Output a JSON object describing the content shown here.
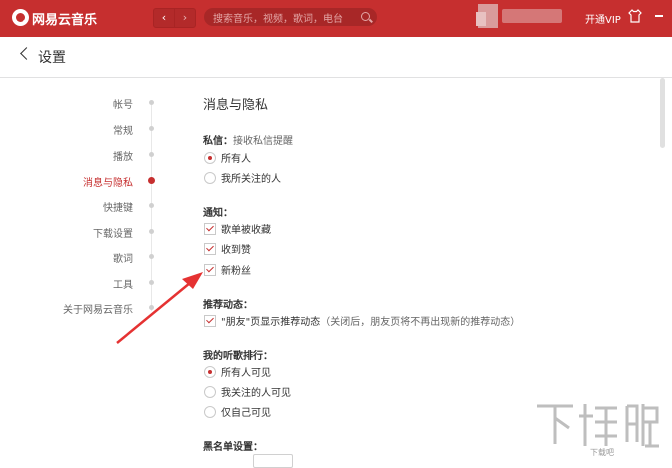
{
  "app": {
    "name": "网易云音乐"
  },
  "topbar": {
    "search_placeholder": "搜索音乐，视频，歌词，电台",
    "vip_label": "开通VIP",
    "nav_back": "‹",
    "nav_forward": "›"
  },
  "header": {
    "title": "设置"
  },
  "sidebar": {
    "items": [
      {
        "label": "帐号",
        "active": false
      },
      {
        "label": "常规",
        "active": false
      },
      {
        "label": "播放",
        "active": false
      },
      {
        "label": "消息与隐私",
        "active": true
      },
      {
        "label": "快捷键",
        "active": false
      },
      {
        "label": "下载设置",
        "active": false
      },
      {
        "label": "歌词",
        "active": false
      },
      {
        "label": "工具",
        "active": false
      },
      {
        "label": "关于网易云音乐",
        "active": false
      }
    ]
  },
  "main": {
    "section_title": "消息与隐私",
    "private_msg": {
      "label": "私信：",
      "note": "接收私信提醒",
      "options": [
        {
          "label": "所有人",
          "selected": true
        },
        {
          "label": "我所关注的人",
          "selected": false
        }
      ]
    },
    "notify": {
      "label": "通知：",
      "options": [
        {
          "label": "歌单被收藏",
          "checked": true
        },
        {
          "label": "收到赞",
          "checked": true
        },
        {
          "label": "新粉丝",
          "checked": true
        }
      ]
    },
    "recommend": {
      "label": "推荐动态：",
      "option_label": "\"朋友\"页显示推荐动态",
      "option_note": "（关闭后，朋友页将不再出现新的推荐动态）",
      "checked": true
    },
    "ranking": {
      "label": "我的听歌排行：",
      "options": [
        {
          "label": "所有人可见",
          "selected": true
        },
        {
          "label": "我关注的人可见",
          "selected": false
        },
        {
          "label": "仅自己可见",
          "selected": false
        }
      ]
    },
    "blacklist": {
      "label": "黑名单设置："
    }
  },
  "watermark": {
    "text": "下载吧"
  },
  "colors": {
    "brand_red": "#c62f2f",
    "text": "#333333",
    "muted": "#666666"
  }
}
